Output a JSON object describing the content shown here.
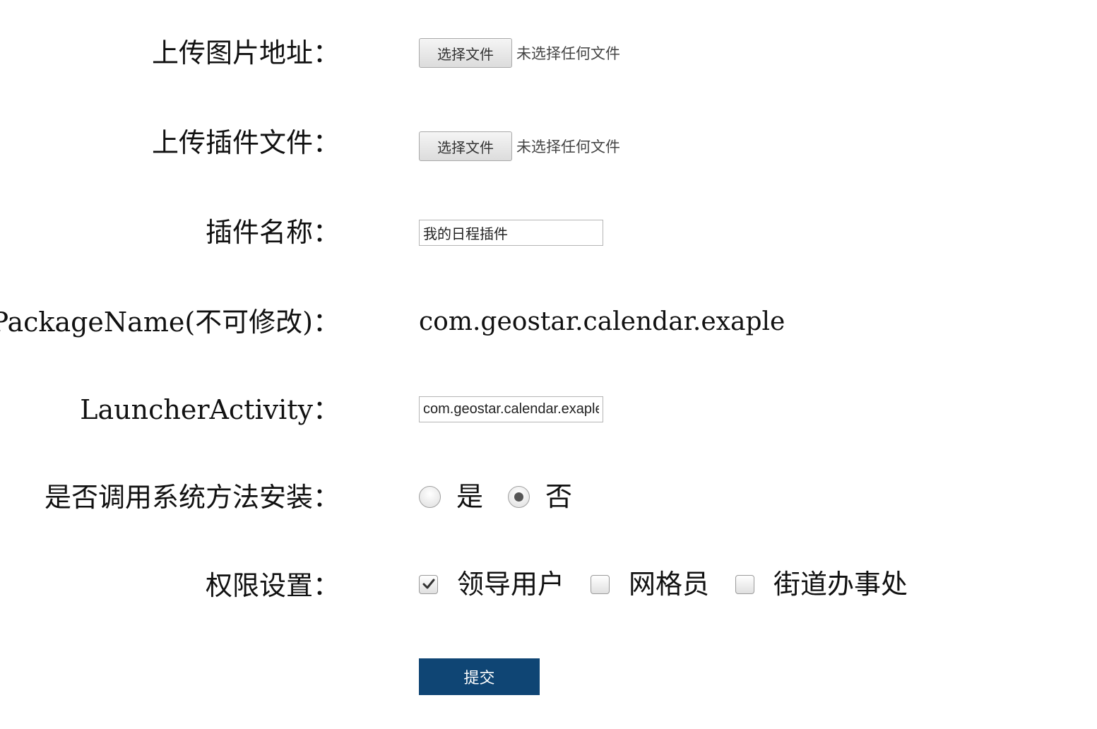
{
  "form": {
    "image_upload": {
      "label": "上传图片地址：",
      "button": "选择文件",
      "status": "未选择任何文件"
    },
    "plugin_upload": {
      "label": "上传插件文件：",
      "button": "选择文件",
      "status": "未选择任何文件"
    },
    "plugin_name": {
      "label": "插件名称：",
      "value": "我的日程插件"
    },
    "package_name": {
      "label": "PackageName(不可修改)：",
      "value": "com.geostar.calendar.exaple"
    },
    "launcher_activity": {
      "label": "LauncherActivity：",
      "value": "com.geostar.calendar.exaple"
    },
    "system_install": {
      "label": "是否调用系统方法安装：",
      "options": [
        {
          "label": "是",
          "selected": false
        },
        {
          "label": "否",
          "selected": true
        }
      ]
    },
    "permissions": {
      "label": "权限设置：",
      "options": [
        {
          "label": "领导用户",
          "checked": true
        },
        {
          "label": "网格员",
          "checked": false
        },
        {
          "label": "街道办事处",
          "checked": false
        }
      ]
    },
    "submit_label": "提交"
  },
  "colors": {
    "submit_bg": "#0f4574",
    "submit_text": "#ffffff"
  }
}
